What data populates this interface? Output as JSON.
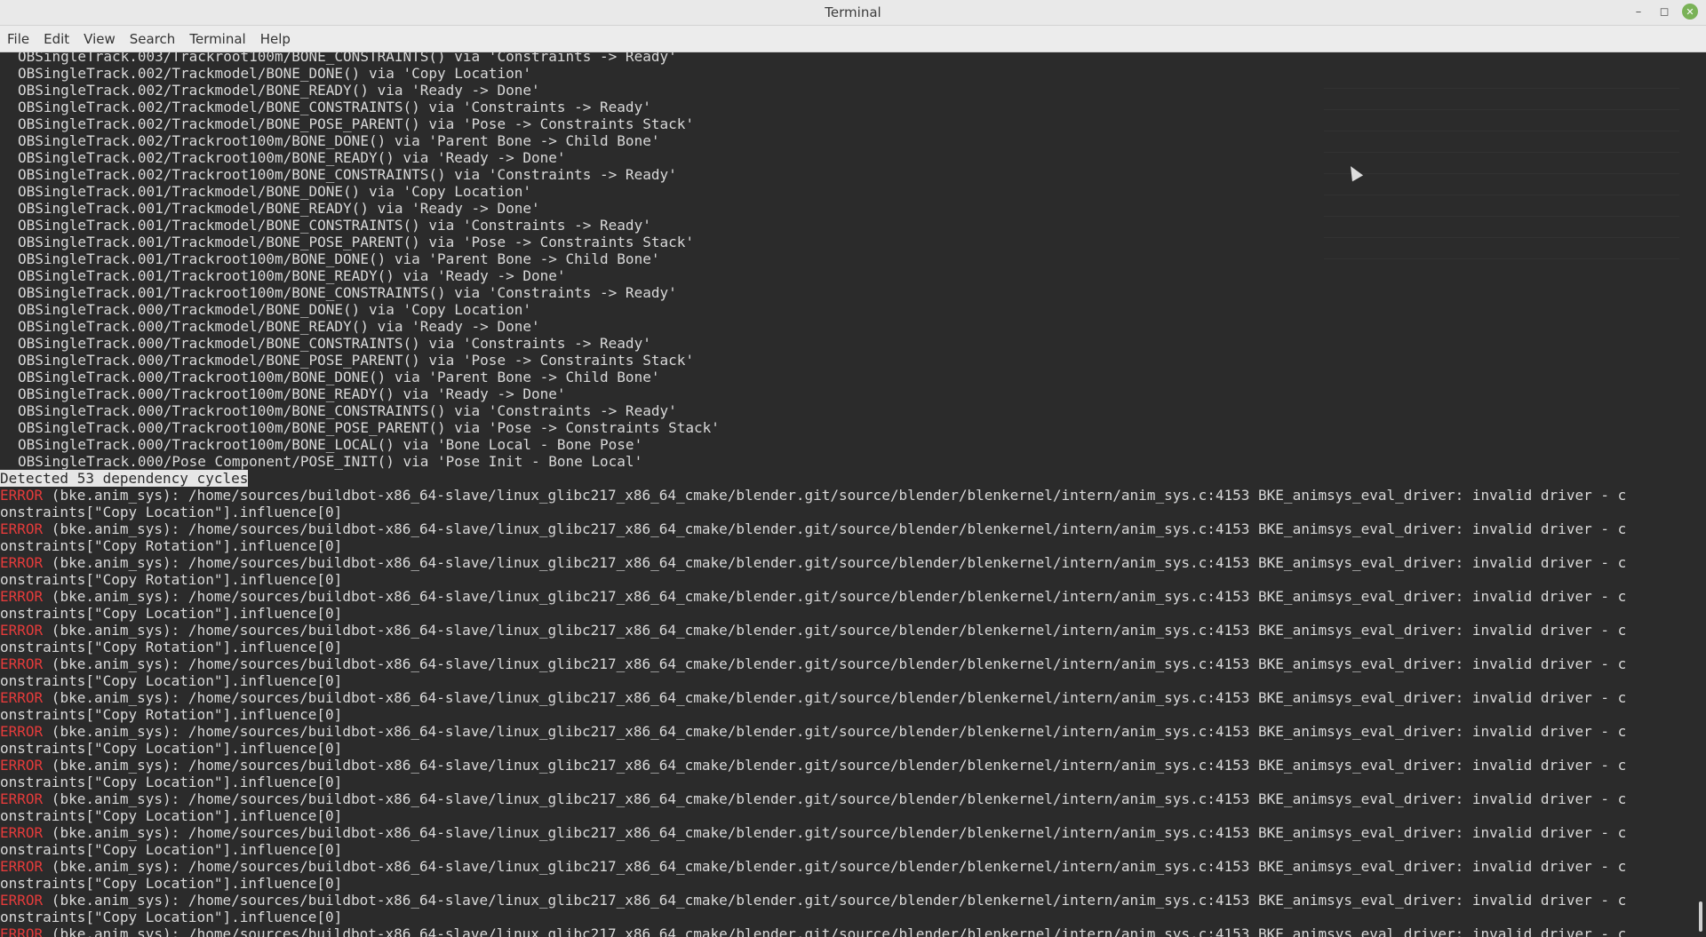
{
  "window": {
    "title": "Terminal"
  },
  "menu": [
    "File",
    "Edit",
    "View",
    "Search",
    "Terminal",
    "Help"
  ],
  "terminal": {
    "top_partial": "OBSingleTrack.003/Trackroot100m/BONE_CONSTRAINTS() via 'Constraints -> Ready'",
    "lines": [
      "OBSingleTrack.002/Trackmodel/BONE_DONE() via 'Copy Location'",
      "OBSingleTrack.002/Trackmodel/BONE_READY() via 'Ready -> Done'",
      "OBSingleTrack.002/Trackmodel/BONE_CONSTRAINTS() via 'Constraints -> Ready'",
      "OBSingleTrack.002/Trackmodel/BONE_POSE_PARENT() via 'Pose -> Constraints Stack'",
      "OBSingleTrack.002/Trackroot100m/BONE_DONE() via 'Parent Bone -> Child Bone'",
      "OBSingleTrack.002/Trackroot100m/BONE_READY() via 'Ready -> Done'",
      "OBSingleTrack.002/Trackroot100m/BONE_CONSTRAINTS() via 'Constraints -> Ready'",
      "OBSingleTrack.001/Trackmodel/BONE_DONE() via 'Copy Location'",
      "OBSingleTrack.001/Trackmodel/BONE_READY() via 'Ready -> Done'",
      "OBSingleTrack.001/Trackmodel/BONE_CONSTRAINTS() via 'Constraints -> Ready'",
      "OBSingleTrack.001/Trackmodel/BONE_POSE_PARENT() via 'Pose -> Constraints Stack'",
      "OBSingleTrack.001/Trackroot100m/BONE_DONE() via 'Parent Bone -> Child Bone'",
      "OBSingleTrack.001/Trackroot100m/BONE_READY() via 'Ready -> Done'",
      "OBSingleTrack.001/Trackroot100m/BONE_CONSTRAINTS() via 'Constraints -> Ready'",
      "OBSingleTrack.000/Trackmodel/BONE_DONE() via 'Copy Location'",
      "OBSingleTrack.000/Trackmodel/BONE_READY() via 'Ready -> Done'",
      "OBSingleTrack.000/Trackmodel/BONE_CONSTRAINTS() via 'Constraints -> Ready'",
      "OBSingleTrack.000/Trackmodel/BONE_POSE_PARENT() via 'Pose -> Constraints Stack'",
      "OBSingleTrack.000/Trackroot100m/BONE_DONE() via 'Parent Bone -> Child Bone'",
      "OBSingleTrack.000/Trackroot100m/BONE_READY() via 'Ready -> Done'",
      "OBSingleTrack.000/Trackroot100m/BONE_CONSTRAINTS() via 'Constraints -> Ready'",
      "OBSingleTrack.000/Trackroot100m/BONE_POSE_PARENT() via 'Pose -> Constraints Stack'",
      "OBSingleTrack.000/Trackroot100m/BONE_LOCAL() via 'Bone Local - Bone Pose'",
      "OBSingleTrack.000/Pose Component/POSE_INIT() via 'Pose Init - Bone Local'"
    ],
    "detected": "Detected 53 dependency cycles",
    "error_tag": "ERROR",
    "error_body": " (bke.anim_sys): /home/sources/buildbot-x86_64-slave/linux_glibc217_x86_64_cmake/blender.git/source/blender/blenkernel/intern/anim_sys.c:4153 BKE_animsys_eval_driver: invalid driver - c",
    "error_continuations": [
      "onstraints[\"Copy Location\"].influence[0]",
      "onstraints[\"Copy Rotation\"].influence[0]",
      "onstraints[\"Copy Rotation\"].influence[0]",
      "onstraints[\"Copy Location\"].influence[0]",
      "onstraints[\"Copy Rotation\"].influence[0]",
      "onstraints[\"Copy Location\"].influence[0]",
      "onstraints[\"Copy Rotation\"].influence[0]",
      "onstraints[\"Copy Location\"].influence[0]",
      "onstraints[\"Copy Location\"].influence[0]",
      "onstraints[\"Copy Location\"].influence[0]",
      "onstraints[\"Copy Location\"].influence[0]",
      "onstraints[\"Copy Location\"].influence[0]",
      "onstraints[\"Copy Location\"].influence[0]"
    ],
    "bottom_partial": " (bke.anim_sys): /home/sources/buildbot-x86_64-slave/linux_glibc217_x86_64_cmake/blender.git/source/blender/blenkernel/intern/anim_sys.c:4153 BKE_animsys_eval_driver: invalid driver - c"
  }
}
